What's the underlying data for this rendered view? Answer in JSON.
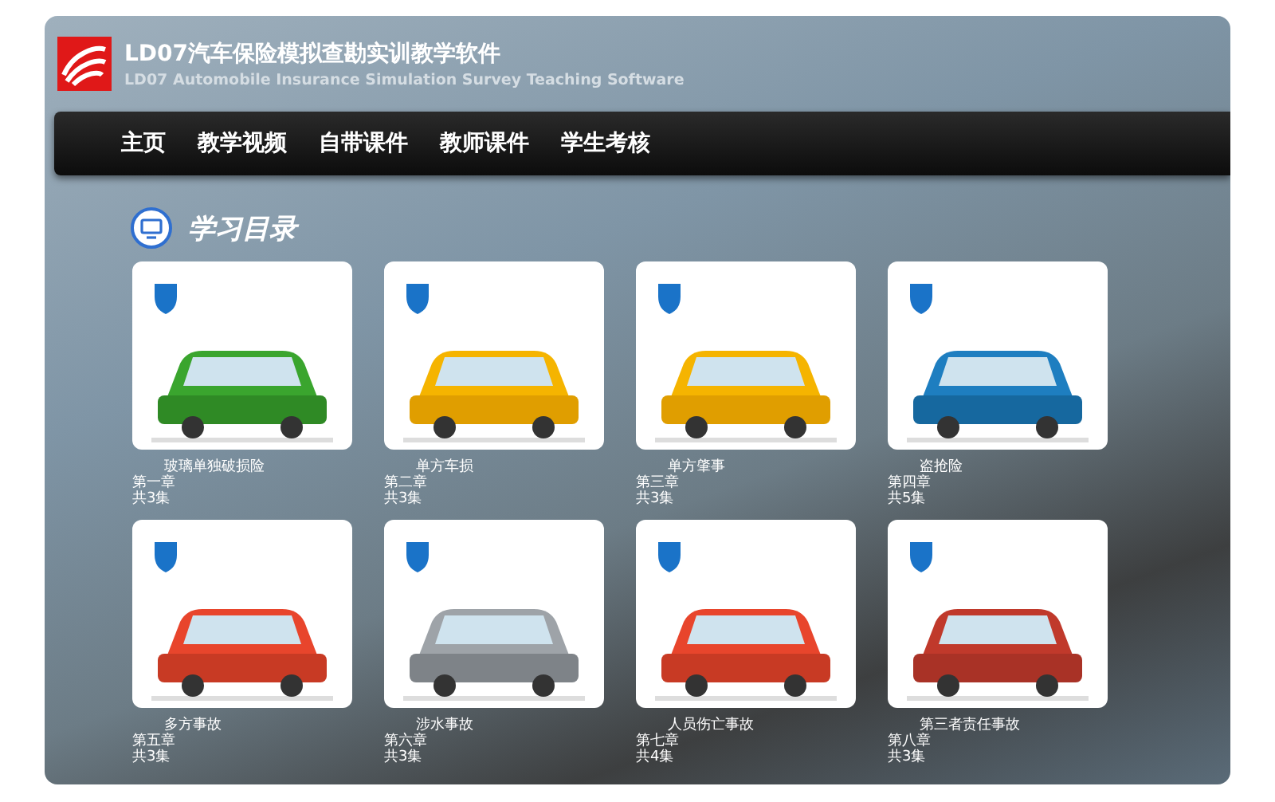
{
  "header": {
    "title": "LD07汽车保险模拟查勘实训教学软件",
    "subtitle": "LD07 Automobile Insurance Simulation Survey Teaching Software"
  },
  "nav": [
    "主页",
    "教学视频",
    "自带课件",
    "教师课件",
    "学生考核"
  ],
  "section": {
    "title": "学习目录"
  },
  "courses": [
    {
      "title": "玻璃单独破损险",
      "chapter": "第一章",
      "count": "共3集"
    },
    {
      "title": "单方车损",
      "chapter": "第二章",
      "count": "共3集"
    },
    {
      "title": "单方肇事",
      "chapter": "第三章",
      "count": "共3集"
    },
    {
      "title": "盗抢险",
      "chapter": "第四章",
      "count": "共5集"
    },
    {
      "title": "多方事故",
      "chapter": "第五章",
      "count": "共3集"
    },
    {
      "title": "涉水事故",
      "chapter": "第六章",
      "count": "共3集"
    },
    {
      "title": "人员伤亡事故",
      "chapter": "第七章",
      "count": "共4集"
    },
    {
      "title": "第三者责任事故",
      "chapter": "第八章",
      "count": "共3集"
    }
  ]
}
